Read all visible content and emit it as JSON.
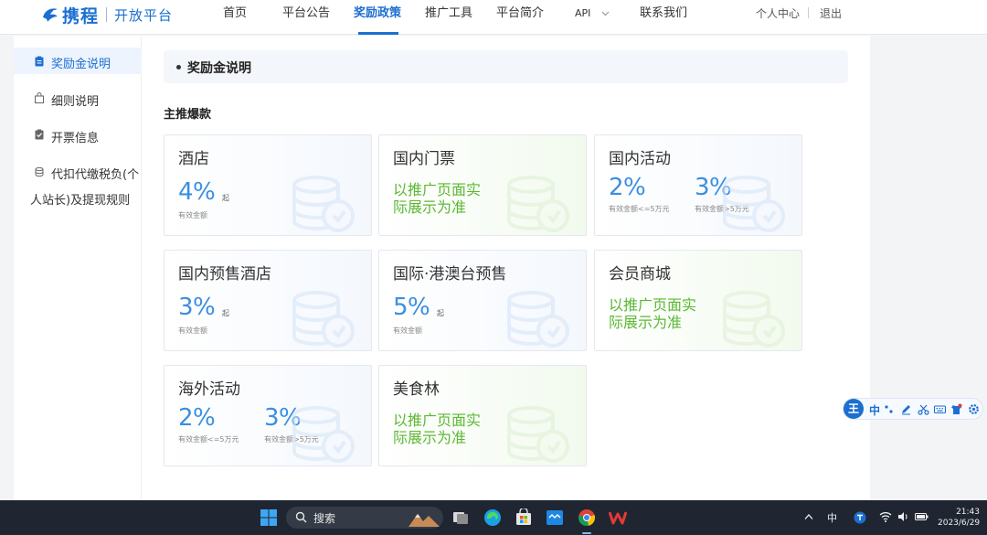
{
  "header": {
    "brand": "携程",
    "platform": "开放平台",
    "nav": [
      {
        "label": "首页"
      },
      {
        "label": "平台公告"
      },
      {
        "label": "奖励政策",
        "active": true
      },
      {
        "label": "推广工具"
      },
      {
        "label": "平台简介"
      },
      {
        "label": "API"
      },
      {
        "label": "联系我们"
      }
    ],
    "user_center": "个人中心",
    "logout": "退出"
  },
  "sidebar": {
    "items": [
      {
        "label": "奖励金说明",
        "active": true,
        "icon": "clipboard-icon"
      },
      {
        "label": "细则说明",
        "icon": "shopping-bag-icon"
      },
      {
        "label": "开票信息",
        "icon": "clipboard-check-icon"
      },
      {
        "label_line1": "代扣代缴税负(个",
        "label_line2": "人站长)及提现规则",
        "icon": "coins-icon"
      }
    ]
  },
  "main": {
    "section_title": "奖励金说明",
    "sub_title": "主推爆款",
    "cards": [
      {
        "title": "酒店",
        "type": "rate",
        "rate": "4%",
        "suffix": "起",
        "desc": "有效金额"
      },
      {
        "title": "国内门票",
        "type": "text",
        "text_line1": "以推广页面实",
        "text_line2": "际展示为准"
      },
      {
        "title": "国内活动",
        "type": "dual",
        "rate1": "2%",
        "desc1": "有效金额<=5万元",
        "rate2": "3%",
        "desc2": "有效金额>5万元"
      },
      {
        "title": "国内预售酒店",
        "type": "rate",
        "rate": "3%",
        "suffix": "起",
        "desc": "有效金额"
      },
      {
        "title": "国际·港澳台预售",
        "type": "rate",
        "rate": "5%",
        "suffix": "起",
        "desc": "有效金额"
      },
      {
        "title": "会员商城",
        "type": "text",
        "text_line1": "以推广页面实",
        "text_line2": "际展示为准"
      },
      {
        "title": "海外活动",
        "type": "dual",
        "rate1": "2%",
        "desc1": "有效金额<=5万元",
        "rate2": "3%",
        "desc2": "有效金额>5万元"
      },
      {
        "title": "美食林",
        "type": "text",
        "text_line1": "以推广页面实",
        "text_line2": "际展示为准"
      }
    ]
  },
  "ime": {
    "logo": "王",
    "mode": "中"
  },
  "taskbar": {
    "search_placeholder": "搜索",
    "input_method": "中",
    "time": "21:43",
    "date": "2023/6/29"
  },
  "colors": {
    "brand_blue": "#1b6fd1",
    "rate_blue": "#3b8fe0",
    "promo_green": "#5cb833"
  }
}
